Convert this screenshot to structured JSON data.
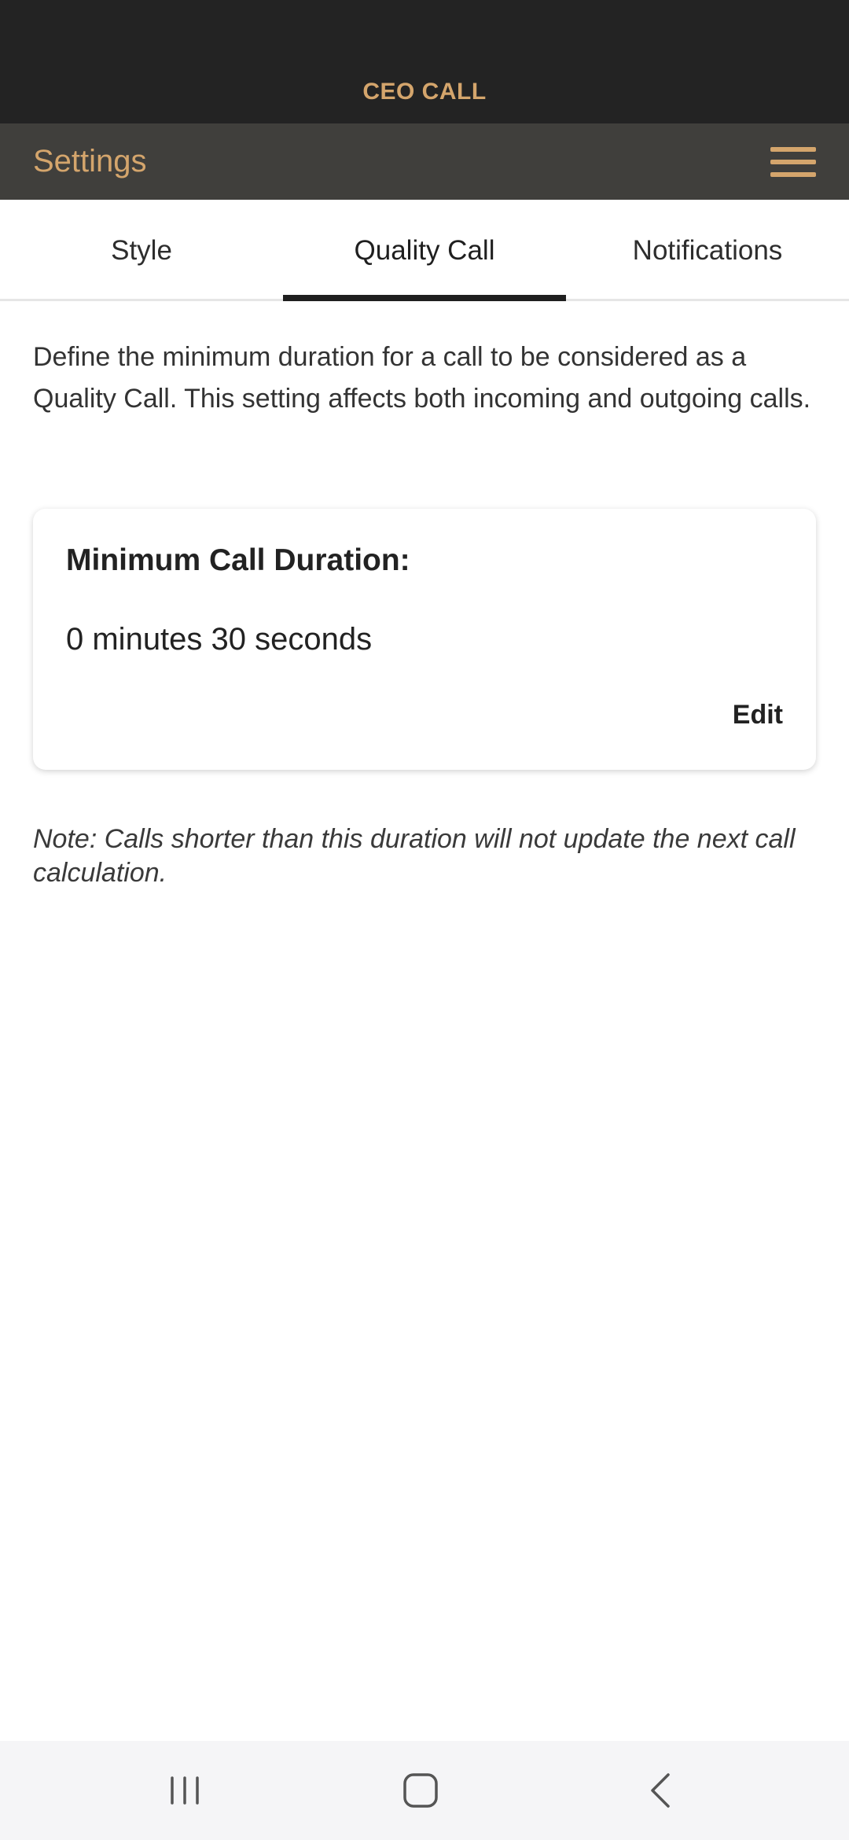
{
  "app": {
    "brand": "CEO CALL"
  },
  "header": {
    "title": "Settings",
    "menu_icon": "hamburger-menu-icon"
  },
  "tabs": [
    {
      "label": "Style",
      "active": false
    },
    {
      "label": "Quality Call",
      "active": true
    },
    {
      "label": "Notifications",
      "active": false
    }
  ],
  "content": {
    "description": "Define the minimum duration for a call to be considered as a Quality Call. This setting affects both incoming and outgoing calls.",
    "card": {
      "title": "Minimum Call Duration:",
      "value": "0 minutes 30 seconds",
      "edit_label": "Edit"
    },
    "note": "Note: Calls shorter than this duration will not update the next call calculation."
  },
  "system_nav": {
    "recents_icon": "recents-icon",
    "home_icon": "home-icon",
    "back_icon": "back-icon"
  },
  "colors": {
    "accent": "#d4a56c",
    "header_bg": "#403f3c",
    "status_bg": "#232323"
  }
}
